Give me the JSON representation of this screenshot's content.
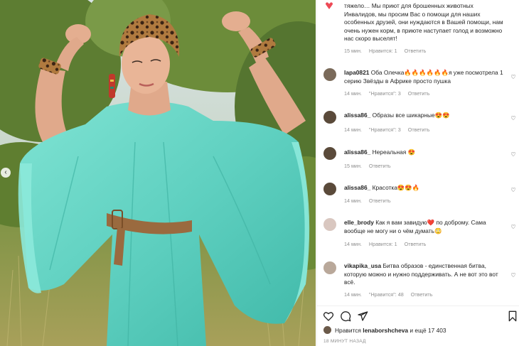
{
  "colors": {
    "dress": "#6fd8c8",
    "text": "#262626",
    "muted": "#8e8e8e",
    "heart": "#ed4956"
  },
  "photo": {
    "nav_prev_icon": "chevron-left-icon",
    "nav_prev_glyph": "‹"
  },
  "comments": [
    {
      "user": "",
      "text": "тяжело… Мы приют для брошенных животных Инвалидов, мы просим Вас о помощи для наших особенных друзей, они нуждаются в Вашей помощи, нам очень нужен корм, в приюте наступает голод и возможно нас скоро выселят!",
      "time": "15 мин.",
      "likes": "Нравится: 1",
      "reply": "Ответить"
    },
    {
      "user": "lapa0821",
      "text": "Оба Олечка🔥🔥🔥🔥🔥🔥я уже посмотрела 1 серию Звёзды в Африке просто пушка",
      "time": "14 мин.",
      "likes": "\"Нравится\": 3",
      "reply": "Ответить"
    },
    {
      "user": "alissa86_",
      "text": "Образы все шикарные😍😍",
      "time": "14 мин.",
      "likes": "\"Нравится\": 3",
      "reply": "Ответить"
    },
    {
      "user": "alissa86_",
      "text": "Нереальная 😍",
      "time": "15 мин.",
      "likes": "",
      "reply": "Ответить"
    },
    {
      "user": "alissa86_",
      "text": "Красотка😍😍🔥",
      "time": "14 мин.",
      "likes": "",
      "reply": "Ответить"
    },
    {
      "user": "elle_brody",
      "text": "Как я вам завидую❤️ по доброму. Сама вообще не могу ни о чём думать😳",
      "time": "14 мин.",
      "likes": "Нравится: 1",
      "reply": "Ответить"
    },
    {
      "user": "vikapika_usa",
      "text": "Битва образов - единственная битва, которую можно и нужно поддерживать. А не вот это вот всё.",
      "time": "14 мин.",
      "likes": "\"Нравится\": 48",
      "reply": "Ответить"
    }
  ],
  "actions": {
    "like_icon": "heart-icon",
    "comment_icon": "comment-icon",
    "share_icon": "share-icon",
    "save_icon": "bookmark-icon"
  },
  "likes_line": {
    "prefix": "Нравится",
    "user": "lenaborshcheva",
    "suffix": "и ещё 17 403"
  },
  "posted": "18 МИНУТ НАЗАД"
}
